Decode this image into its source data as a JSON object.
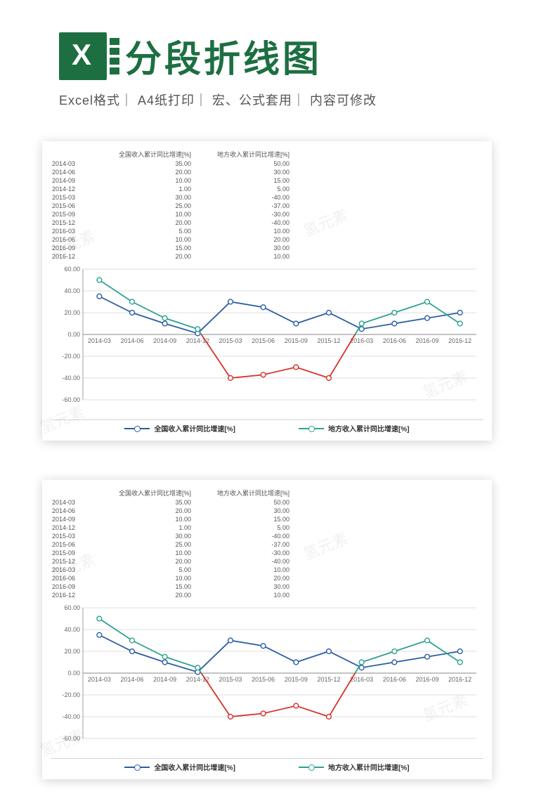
{
  "header": {
    "title": "分段折线图"
  },
  "subtitle": "Excel格式｜ A4纸打印｜ 宏、公式套用｜ 内容可修改",
  "watermark_text": "氢元素",
  "chart_data": {
    "type": "line",
    "table_headers": [
      "全国收入累计同比增速[%]",
      "地方收入累计同比增速[%]"
    ],
    "categories": [
      "2014-03",
      "2014-06",
      "2014-09",
      "2014-12",
      "2015-03",
      "2015-06",
      "2015-09",
      "2015-12",
      "2016-03",
      "2016-06",
      "2016-09",
      "2016-12"
    ],
    "series": [
      {
        "name": "全国收入累计同比增速[%]",
        "values": [
          35.0,
          20.0,
          10.0,
          1.0,
          30.0,
          25.0,
          10.0,
          20.0,
          5.0,
          10.0,
          15.0,
          20.0
        ]
      },
      {
        "name": "地方收入累计同比增速[%]",
        "values": [
          50.0,
          30.0,
          15.0,
          5.0,
          -40.0,
          -37.0,
          -30.0,
          -40.0,
          10.0,
          20.0,
          30.0,
          10.0
        ]
      }
    ],
    "ylim": [
      -60,
      60
    ],
    "yticks": [
      60.0,
      40.0,
      20.0,
      0.0,
      -20.0,
      -40.0,
      -60.0
    ],
    "xlabel": "",
    "ylabel": "",
    "legend_labels": [
      "全国收入累计同比增速[%]",
      "地方收入累计同比增速[%]"
    ],
    "segment_color_rule": "series 2 values below zero drawn in red"
  }
}
